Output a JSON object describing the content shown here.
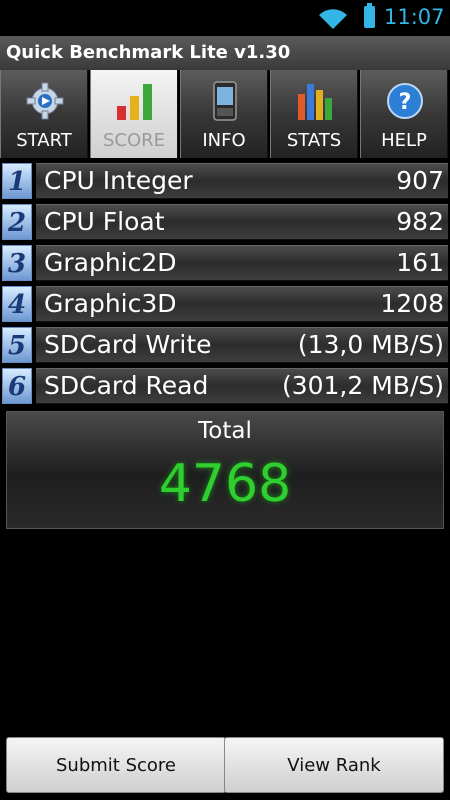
{
  "status": {
    "time": "11:07"
  },
  "app": {
    "title": "Quick Benchmark Lite v1.30"
  },
  "tabs": [
    {
      "label": "START",
      "icon": "gear-icon"
    },
    {
      "label": "SCORE",
      "icon": "bar-chart-icon",
      "active": true
    },
    {
      "label": "INFO",
      "icon": "phone-icon"
    },
    {
      "label": "STATS",
      "icon": "stats-icon"
    },
    {
      "label": "HELP",
      "icon": "help-icon"
    }
  ],
  "scores": [
    {
      "num": "1",
      "name": "CPU Integer",
      "value": "907"
    },
    {
      "num": "2",
      "name": "CPU Float",
      "value": "982"
    },
    {
      "num": "3",
      "name": "Graphic2D",
      "value": "161"
    },
    {
      "num": "4",
      "name": "Graphic3D",
      "value": "1208"
    },
    {
      "num": "5",
      "name": "SDCard Write",
      "value": "(13,0 MB/S)"
    },
    {
      "num": "6",
      "name": "SDCard Read",
      "value": "(301,2 MB/S)"
    }
  ],
  "total": {
    "label": "Total",
    "value": "4768"
  },
  "buttons": {
    "submit": "Submit Score",
    "rank": "View Rank"
  },
  "colors": {
    "accent": "#33b5e5",
    "total_value": "#2ecf2e",
    "row_number": "#1a3a78"
  }
}
